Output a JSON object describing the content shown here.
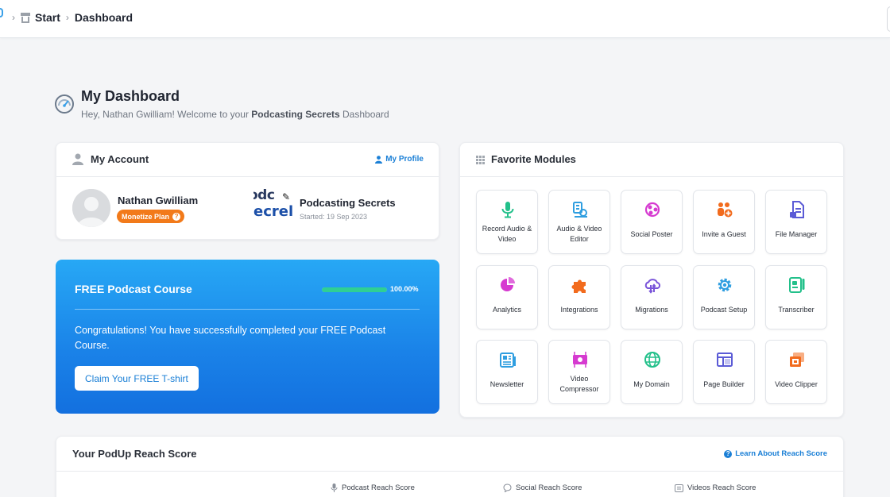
{
  "breadcrumb": {
    "items": [
      "Start",
      "Dashboard"
    ]
  },
  "header": {
    "title": "My Dashboard",
    "welcome_prefix": "Hey, Nathan Gwilliam! Welcome to your ",
    "welcome_podcast": "Podcasting Secrets",
    "welcome_suffix": " Dashboard"
  },
  "account": {
    "title": "My Account",
    "profile_link": "My Profile",
    "user_name": "Nathan Gwilliam",
    "plan": "Monetize Plan",
    "podcast_logo_lines": [
      "odc",
      "ecrel"
    ],
    "podcast_name": "Podcasting Secrets",
    "started": "Started: 19 Sep 2023"
  },
  "course": {
    "title": "FREE Podcast Course",
    "progress": 1.0,
    "progress_label": "100.00%",
    "message": "Congratulations! You have successfully completed your FREE Podcast Course.",
    "button": "Claim Your FREE T-shirt"
  },
  "favorites": {
    "title": "Favorite Modules",
    "modules": [
      {
        "label": "Record Audio & Video",
        "icon": "microphone-icon",
        "color": "#22c08a"
      },
      {
        "label": "Audio & Video Editor",
        "icon": "media-editor-icon",
        "color": "#2f9ee0"
      },
      {
        "label": "Social Poster",
        "icon": "share-icon",
        "color": "#d63ad0"
      },
      {
        "label": "Invite a Guest",
        "icon": "invite-guest-icon",
        "color": "#f26b1d"
      },
      {
        "label": "File Manager",
        "icon": "file-manager-icon",
        "color": "#5b5bd6"
      },
      {
        "label": "Analytics",
        "icon": "pie-chart-icon",
        "color": "#d63ad0"
      },
      {
        "label": "Integrations",
        "icon": "puzzle-icon",
        "color": "#f26b1d"
      },
      {
        "label": "Migrations",
        "icon": "cloud-migrate-icon",
        "color": "#7a55d9"
      },
      {
        "label": "Podcast Setup",
        "icon": "gear-icon",
        "color": "#2f9ee0"
      },
      {
        "label": "Transcriber",
        "icon": "transcriber-icon",
        "color": "#22c08a"
      },
      {
        "label": "Newsletter",
        "icon": "newsletter-icon",
        "color": "#2f9ee0"
      },
      {
        "label": "Video Compressor",
        "icon": "video-compressor-icon",
        "color": "#d63ad0"
      },
      {
        "label": "My Domain",
        "icon": "globe-icon",
        "color": "#22c08a"
      },
      {
        "label": "Page Builder",
        "icon": "page-builder-icon",
        "color": "#5b5bd6"
      },
      {
        "label": "Video Clipper",
        "icon": "video-clipper-icon",
        "color": "#f26b1d"
      }
    ]
  },
  "reach": {
    "title": "Your PodUp Reach Score",
    "learn_link": "Learn About Reach Score",
    "columns": [
      "Podcast Reach Score",
      "Social Reach Score",
      "Videos Reach Score"
    ]
  }
}
